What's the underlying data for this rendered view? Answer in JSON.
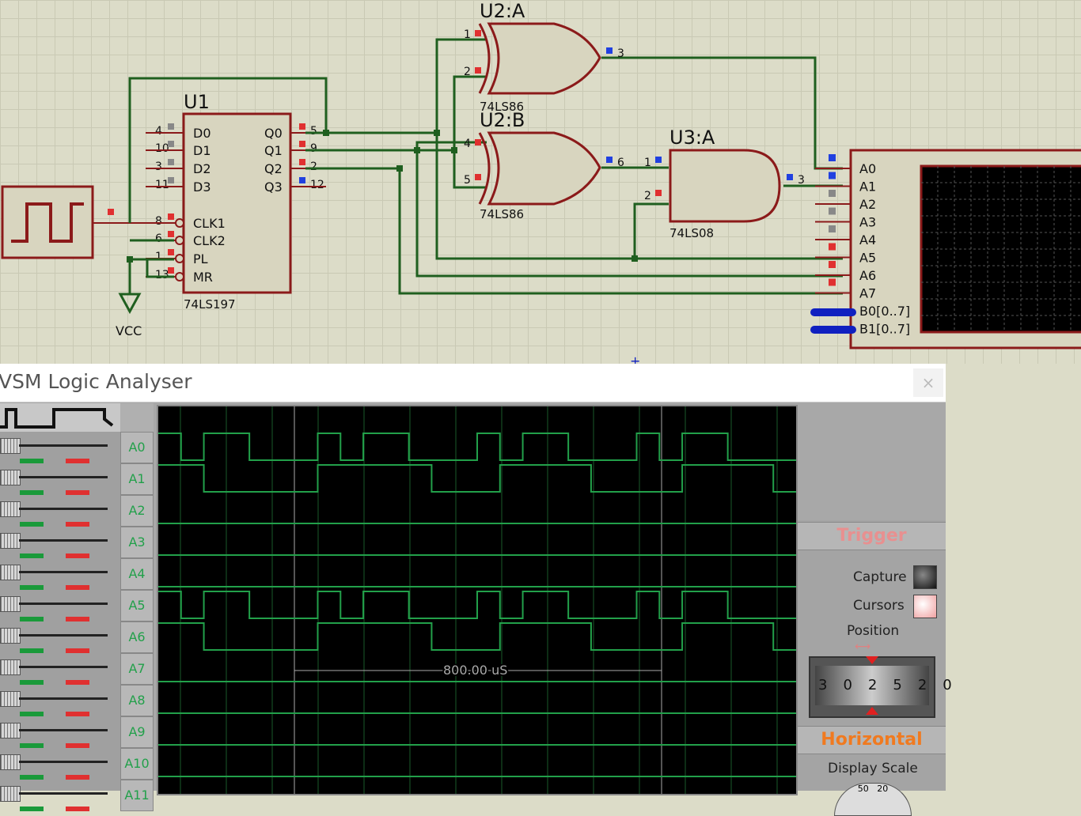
{
  "schematic": {
    "counter": {
      "ref": "U1",
      "part": "74LS197",
      "left_pins": [
        "D0",
        "D1",
        "D2",
        "D3",
        "CLK1",
        "CLK2",
        "PL",
        "MR"
      ],
      "left_pin_nums": [
        "4",
        "10",
        "3",
        "11",
        "8",
        "6",
        "1",
        "13"
      ],
      "right_pins": [
        "Q0",
        "Q1",
        "Q2",
        "Q3"
      ],
      "right_pin_nums": [
        "5",
        "9",
        "2",
        "12"
      ]
    },
    "xor_a": {
      "ref": "U2:A",
      "part": "74LS86",
      "in1": "1",
      "in2": "2",
      "out": "3"
    },
    "xor_b": {
      "ref": "U2:B",
      "part": "74LS86",
      "in1": "4",
      "in2": "5",
      "out": "6"
    },
    "and_a": {
      "ref": "U3:A",
      "part": "74LS08",
      "in1": "1",
      "in2": "2",
      "out": "3"
    },
    "vcc_label": "VCC",
    "analyser_pins": [
      "A0",
      "A1",
      "A2",
      "A3",
      "A4",
      "A5",
      "A6",
      "A7",
      "B0[0..7]",
      "B1[0..7]"
    ]
  },
  "analyser": {
    "title": "VSM Logic Analyser",
    "close": "×",
    "channels": [
      "A0",
      "A1",
      "A2",
      "A3",
      "A4",
      "A5",
      "A6",
      "A7",
      "A8",
      "A9",
      "A10",
      "A11"
    ],
    "cursor_readout": "800.00 uS",
    "trigger_label": "Trigger",
    "capture_label": "Capture",
    "cursors_label": "Cursors",
    "position_label": "Position",
    "position_ticks": [
      "30",
      "25",
      "20"
    ],
    "horizontal_label": "Horizontal",
    "display_scale_label": "Display Scale",
    "display_scale_ticks": [
      "50",
      "20"
    ],
    "colors": {
      "trace": "#22a04a",
      "trigger": "#e89090",
      "horizontal": "#f07a20"
    },
    "traces": {
      "A0": [
        1,
        0,
        1,
        1,
        0,
        0,
        0,
        1,
        0,
        1,
        1,
        0,
        0,
        0,
        1,
        0,
        1,
        1,
        0,
        0,
        0,
        1,
        0,
        1,
        1,
        0,
        0,
        0
      ],
      "A1": [
        1,
        1,
        0,
        0,
        0,
        0,
        0,
        1,
        1,
        1,
        1,
        1,
        0,
        0,
        0,
        1,
        1,
        1,
        1,
        0,
        0,
        0,
        0,
        1,
        1,
        1,
        1,
        0
      ],
      "A5": [
        1,
        0,
        1,
        1,
        0,
        0,
        0,
        1,
        0,
        1,
        1,
        0,
        0,
        0,
        1,
        0,
        1,
        1,
        0,
        0,
        0,
        1,
        0,
        1,
        1,
        0,
        0,
        0
      ],
      "A6": [
        1,
        1,
        0,
        0,
        0,
        0,
        0,
        1,
        1,
        1,
        1,
        1,
        0,
        0,
        0,
        1,
        1,
        1,
        1,
        0,
        0,
        0,
        0,
        1,
        1,
        1,
        1,
        0
      ]
    }
  }
}
